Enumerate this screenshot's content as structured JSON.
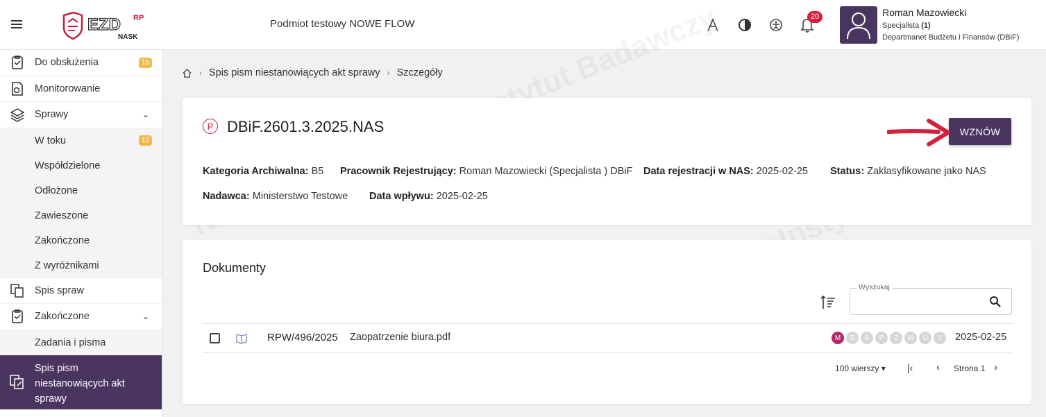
{
  "header": {
    "logo_text": "EZD",
    "logo_sup": "RP",
    "logo_sub": "NASK",
    "entity": "Podmiot testowy NOWE FLOW",
    "font_size_icon": "font-size-icon",
    "contrast_icon": "contrast-icon",
    "accessibility_icon": "accessibility-icon",
    "bell_count": "20",
    "user_name": "Roman Mazowiecki",
    "user_role": "Specjalista",
    "user_role_count": "(1)",
    "user_dept": "Departmanet Budżetu i Finansów (DBiF)"
  },
  "sidebar": {
    "items": [
      {
        "label": "Do obsłużenia",
        "badge": "15"
      },
      {
        "label": "Monitorowanie"
      },
      {
        "label": "Sprawy"
      },
      {
        "label": "W toku",
        "badge": "12"
      },
      {
        "label": "Współdzielone"
      },
      {
        "label": "Odłożone"
      },
      {
        "label": "Zawieszone"
      },
      {
        "label": "Zakończone"
      },
      {
        "label": "Z wyróżnikami"
      },
      {
        "label": "Spis spraw"
      },
      {
        "label": "Zakończone"
      },
      {
        "label": "Zadania i pisma"
      },
      {
        "label": "Spis pism niestanowiących akt sprawy"
      }
    ]
  },
  "breadcrumb": {
    "home": "home-icon",
    "level1": "Spis pism niestanowiących akt sprawy",
    "level2": "Szczegóły"
  },
  "case": {
    "badge": "P",
    "title": "DBiF.2601.3.2025.NAS",
    "resume_label": "WZNÓW",
    "meta": [
      {
        "label": "Kategoria Archiwalna:",
        "value": "B5"
      },
      {
        "label": "Pracownik Rejestrujący:",
        "value": "Roman Mazowiecki (Specjalista ) DBiF"
      },
      {
        "label": "Data rejestracji w NAS:",
        "value": "2025-02-25"
      },
      {
        "label": "Status:",
        "value": "Zaklasyfikowane jako NAS"
      },
      {
        "label": "Nadawca:",
        "value": "Ministerstwo Testowe"
      },
      {
        "label": "Data wpływu:",
        "value": "2025-02-25"
      }
    ]
  },
  "documents": {
    "title": "Dokumenty",
    "search_label": "Wyszukaj",
    "search_value": "",
    "rows": [
      {
        "number": "RPW/496/2025",
        "name": "Zaopatrzenie biura.pdf",
        "date": "2025-02-25",
        "flags": [
          "M",
          "S",
          "A",
          "P",
          "Z",
          "W",
          "U",
          "V"
        ]
      }
    ],
    "rows_per_page": "100 wierszy",
    "page_label": "Strona 1"
  },
  "colors": {
    "brand": "#4a3560",
    "accent_red": "#c81d3f",
    "badge_orange": "#f2b94a",
    "flag_active": "#b02a6b"
  }
}
